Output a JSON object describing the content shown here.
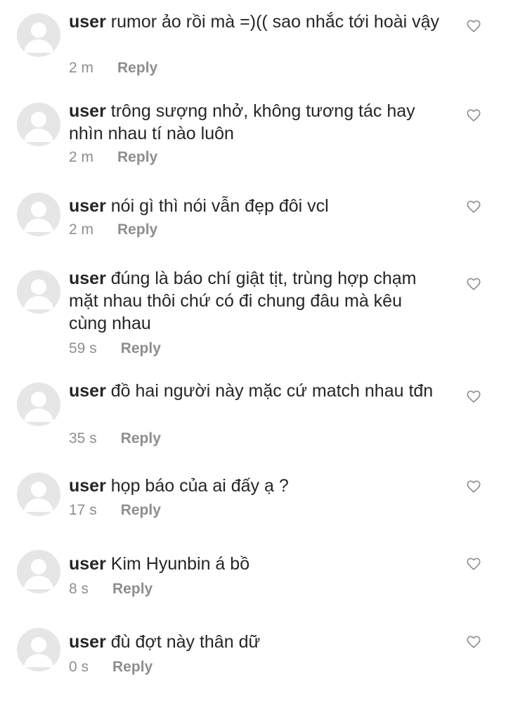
{
  "comments": [
    {
      "username": "user",
      "text": "rumor ảo rồi mà =)(( sao nhắc tới hoài vậy",
      "time": "2 m",
      "reply_label": "Reply"
    },
    {
      "username": "user",
      "text": "trông sượng nhở, không tương tác hay nhìn nhau tí nào luôn",
      "time": "2 m",
      "reply_label": "Reply"
    },
    {
      "username": "user",
      "text": "nói gì thì nói vẫn đẹp đôi vcl",
      "time": "2 m",
      "reply_label": "Reply"
    },
    {
      "username": "user",
      "text": "đúng là báo chí giật tịt, trùng hợp chạm mặt nhau thôi chứ có đi chung đâu mà kêu cùng nhau",
      "time": "59 s",
      "reply_label": "Reply"
    },
    {
      "username": "user",
      "text": "đồ hai người này mặc cứ match nhau tđn",
      "time": "35 s",
      "reply_label": "Reply"
    },
    {
      "username": "user",
      "text": "họp báo của ai đấy ạ ?",
      "time": "17 s",
      "reply_label": "Reply"
    },
    {
      "username": "user",
      "text": "Kim Hyunbin á bồ",
      "time": "8 s",
      "reply_label": "Reply"
    },
    {
      "username": "user",
      "text": "đù đợt này thân dữ",
      "time": "0 s",
      "reply_label": "Reply"
    }
  ],
  "icons": {
    "avatar": "default-avatar-icon",
    "like": "heart-outline-icon"
  },
  "colors": {
    "text": "#262626",
    "meta": "#8e8e8e",
    "avatar_bg": "#e6e6e6",
    "avatar_fg": "#ffffff"
  }
}
